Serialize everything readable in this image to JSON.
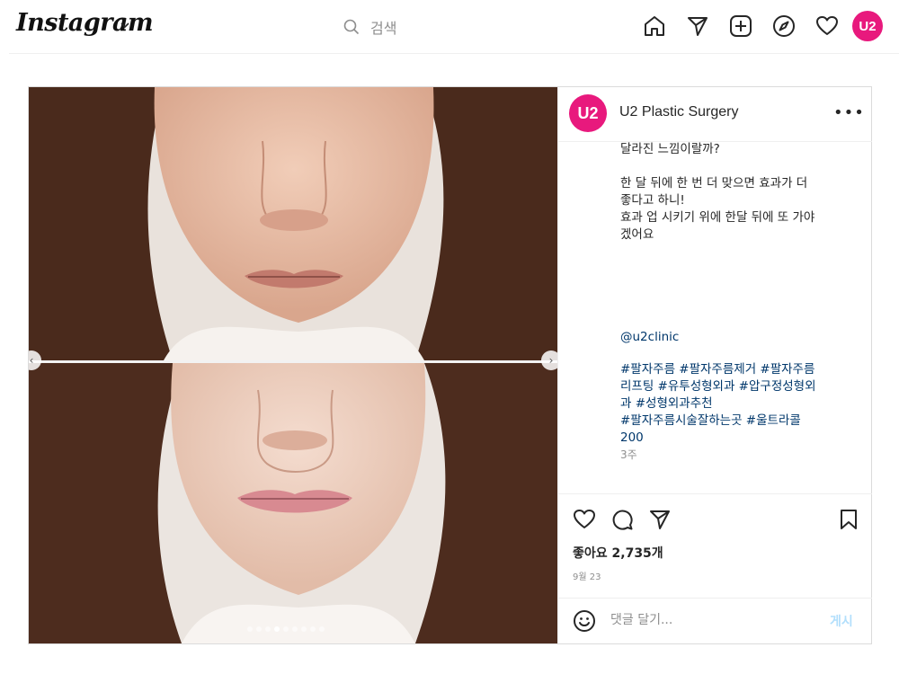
{
  "nav": {
    "logo": "Instagram",
    "search_placeholder": "검색",
    "avatar_text": "U2"
  },
  "post": {
    "username": "U2 Plastic Surgery",
    "avatar_text": "U2",
    "caption": {
      "line1": "달라진 느낌이랄까?",
      "para2_line1": "한 달 뒤에 한 번 더 맞으면 효과가 더",
      "para2_line2": "좋다고 하니!",
      "para2_line3": "효과 업 시키기 위에 한달 뒤에 또 가야",
      "para2_line4": "겠어요",
      "mention": "@u2clinic",
      "tags_line1": "#팔자주름 #팔자주름제거 #팔자주름",
      "tags_line2": "리프팅 #유투성형외과 #압구정성형외",
      "tags_line3": "과 #성형외과추천",
      "tags_line4": "#팔자주름시술잘하는곳 #울트라콜",
      "tags_line5": "200",
      "time_ago": "3주"
    },
    "likes": "좋아요 2,735개",
    "date": "9월 23",
    "comment_placeholder": "댓글 달기...",
    "post_button": "게시",
    "carousel": {
      "total": 9,
      "active_index": 3
    }
  },
  "colors": {
    "brand_pink": "#e8197d",
    "link_blue": "#00376b",
    "post_disabled": "#b2dffc"
  },
  "icons": [
    "home-icon",
    "send-icon",
    "new-post-icon",
    "explore-icon",
    "heart-icon",
    "search-icon",
    "chevron-down-icon",
    "more-icon",
    "comment-icon",
    "bookmark-icon",
    "emoji-icon"
  ]
}
